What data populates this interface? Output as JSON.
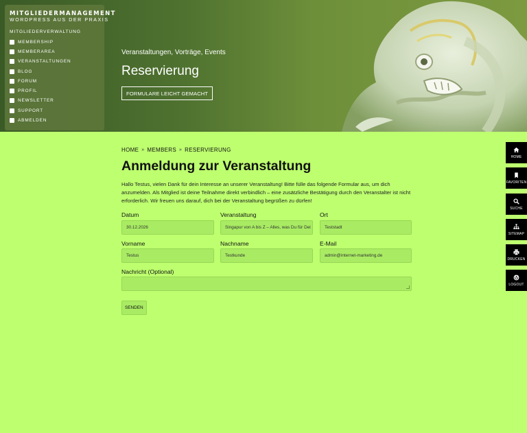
{
  "brand": {
    "line1": "MITGLIEDERMANAGEMENT",
    "line2": "WORDPRESS AUS DER PRAXIS"
  },
  "menu": {
    "heading": "MITGLIEDERVERWALTUNG",
    "items": [
      {
        "label": "MEMBERSHIP"
      },
      {
        "label": "MEMBERAREA"
      },
      {
        "label": "VERANSTALTUNGEN"
      },
      {
        "label": "BLOG"
      },
      {
        "label": "FORUM"
      },
      {
        "label": "PROFIL"
      },
      {
        "label": "NEWSLETTER"
      },
      {
        "label": "SUPPORT"
      },
      {
        "label": "ABMELDEN"
      }
    ]
  },
  "hero": {
    "subtitle": "Veranstaltungen, Vorträge, Events",
    "title": "Reservierung",
    "button": "FORMULARE LEICHT GEMACHT"
  },
  "breadcrumb": {
    "items": [
      "HOME",
      "MEMBERS",
      "RESERVIERUNG"
    ],
    "separator": "»"
  },
  "page": {
    "title": "Anmeldung zur Veranstaltung",
    "intro": "Hallo Testus, vielen Dank für dein Interesse an unserer Veranstaltung! Bitte fülle das folgende Formular aus, um dich anzumelden. Als Mitglied ist deine Teilnahme direkt verbindlich – eine zusätzliche Bestätigung durch den Veranstalter ist nicht erforderlich. Wir freuen uns darauf, dich bei der Veranstaltung begrüßen zu dürfen!"
  },
  "form": {
    "datum": {
      "label": "Datum",
      "value": "30.12.2026"
    },
    "veranstaltung": {
      "label": "Veranstaltung",
      "value": "Singapur von A bis Z – Alles, was Du für Dei"
    },
    "ort": {
      "label": "Ort",
      "value": "Teststadt"
    },
    "vorname": {
      "label": "Vorname",
      "value": "Testus"
    },
    "nachname": {
      "label": "Nachname",
      "value": "Testkunde"
    },
    "email": {
      "label": "E-Mail",
      "value": "admin@internet-marketing.de"
    },
    "nachricht": {
      "label": "Nachricht (Optional)",
      "value": ""
    },
    "submit": "SENDEN"
  },
  "toolbar": [
    {
      "label": "HOME",
      "icon": "home-icon"
    },
    {
      "label": "FAVORITEN",
      "icon": "bookmark-icon"
    },
    {
      "label": "SUCHE",
      "icon": "search-icon"
    },
    {
      "label": "SITEMAP",
      "icon": "sitemap-icon"
    },
    {
      "label": "DRUCKEN",
      "icon": "printer-icon"
    },
    {
      "label": "LOGOUT",
      "icon": "power-icon"
    }
  ],
  "colors": {
    "page_bg": "#bdff6f",
    "field_bg": "#a9ec63",
    "toolbar_bg": "#000000"
  }
}
